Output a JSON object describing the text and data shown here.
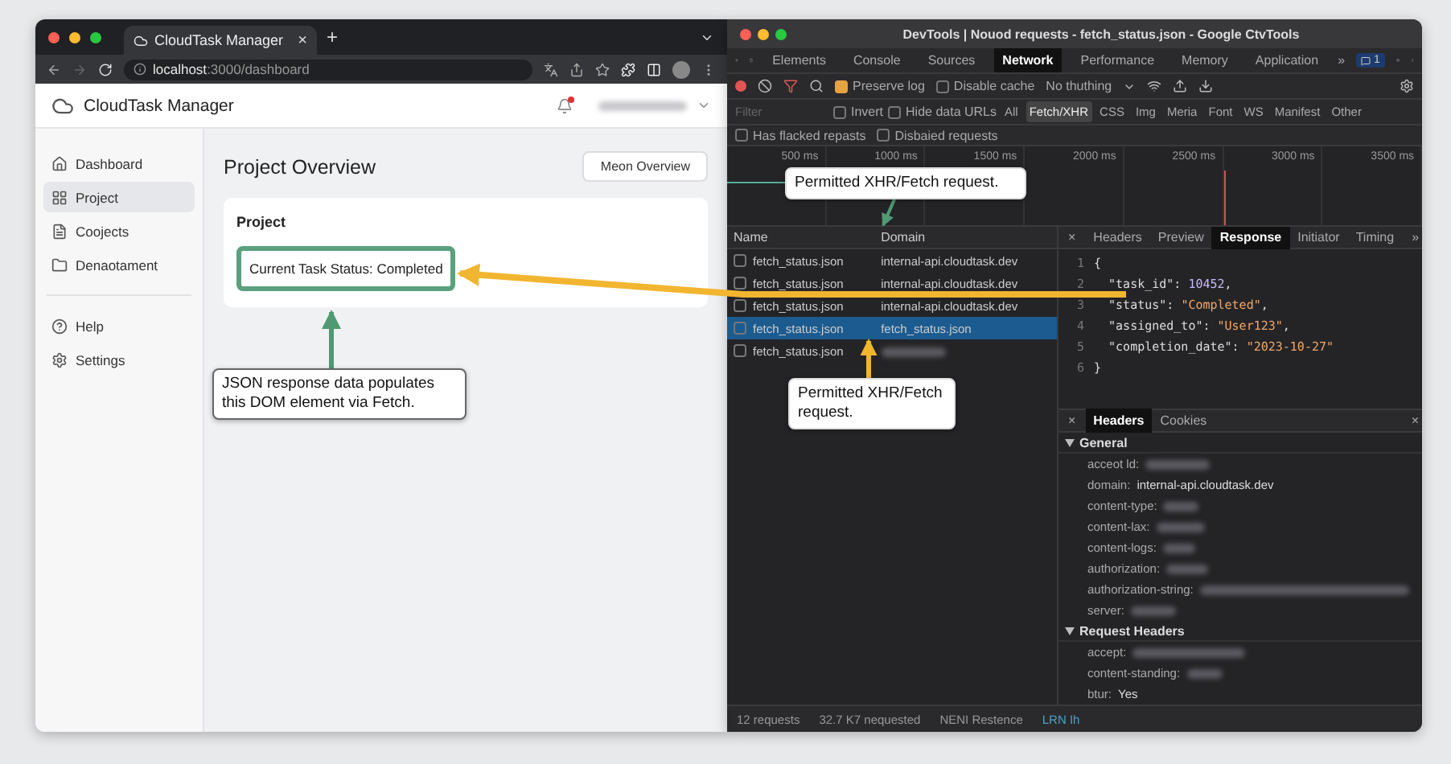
{
  "browser": {
    "tab_title": "CloudTask Manager",
    "tab_close": "×",
    "new_tab": "+",
    "url_host": "localhost",
    "url_path": ":3000/dashboard"
  },
  "app": {
    "brand": "CloudTask Manager",
    "nav": [
      {
        "label": "Dashboard",
        "selected": false
      },
      {
        "label": "Project",
        "selected": true
      },
      {
        "label": "Coojects",
        "selected": false
      },
      {
        "label": "Denaotament",
        "selected": false
      }
    ],
    "nav_footer": [
      {
        "label": "Help",
        "selected": false
      },
      {
        "label": "Settings",
        "selected": false
      }
    ],
    "title": "Project Overview",
    "button": "Meon Overview",
    "card_title": "Project",
    "status_text": "Current Task Status: Completed"
  },
  "annotations": {
    "dom_note": "JSON response data populates this DOM element via Fetch.",
    "xhr_note_top": "Permitted XHR/Fetch request.",
    "xhr_note_bottom": "Permitted XHR/Fetch request."
  },
  "devtools": {
    "title": "DevTools | Nouod requests - fetch_status.json - Google CtvTools",
    "tabs": [
      {
        "label": "Elements",
        "selected": false
      },
      {
        "label": "Console",
        "selected": false
      },
      {
        "label": "Sources",
        "selected": false
      },
      {
        "label": "Network",
        "selected": true
      },
      {
        "label": "Performance",
        "selected": false
      },
      {
        "label": "Memory",
        "selected": false
      },
      {
        "label": "Application",
        "selected": false
      }
    ],
    "more": "»",
    "badge": "1",
    "preserve_log": {
      "label": "Preserve log",
      "checked": true
    },
    "disable_cache": {
      "label": "Disable cache",
      "checked": false
    },
    "throttling": "No thuthing",
    "filter_placeholder": "Filter",
    "filter_checks": [
      {
        "label": "Invert",
        "checked": false
      },
      {
        "label": "Hide data URLs",
        "checked": false
      }
    ],
    "types": [
      {
        "label": "All",
        "selected": false
      },
      {
        "label": "Fetch/XHR",
        "selected": true
      },
      {
        "label": "CSS",
        "selected": false
      },
      {
        "label": "Img",
        "selected": false
      },
      {
        "label": "Meria",
        "selected": false
      },
      {
        "label": "Font",
        "selected": false
      },
      {
        "label": "WS",
        "selected": false
      },
      {
        "label": "Manifest",
        "selected": false
      },
      {
        "label": "Other",
        "selected": false
      }
    ],
    "extra_checks": [
      {
        "label": "Has flacked repasts",
        "checked": false
      },
      {
        "label": "Disbaied requests",
        "checked": false
      }
    ],
    "ticks": [
      "500 ms",
      "1000 ms",
      "1500 ms",
      "2000 ms",
      "2500 ms",
      "3000 ms",
      "3500 ms"
    ],
    "columns": [
      "Name",
      "Domain"
    ],
    "rows": [
      {
        "name": "fetch_status.json",
        "domain": "internal-api.cloudtask.dev",
        "selected": false
      },
      {
        "name": "fetch_status.json",
        "domain": "internal-api.cloudtask.dev",
        "selected": false
      },
      {
        "name": "fetch_status.json",
        "domain": "internal-api.cloudtask.dev",
        "selected": false
      },
      {
        "name": "fetch_status.json",
        "domain": "fetch_status.json",
        "selected": true
      },
      {
        "name": "fetch_status.json",
        "selected": false
      }
    ],
    "detail_close": "×",
    "detail_tabs": [
      {
        "label": "Headers",
        "selected": false
      },
      {
        "label": "Preview",
        "selected": false
      },
      {
        "label": "Response",
        "selected": true
      },
      {
        "label": "Initiator",
        "selected": false
      },
      {
        "label": "Timing",
        "selected": false
      }
    ],
    "detail_more": "»",
    "code": [
      {
        "number": "1",
        "text": "{"
      },
      {
        "number": "2",
        "key": "\"task_id\": ",
        "value": "10452",
        "kind": "number",
        "tail": ","
      },
      {
        "number": "3",
        "key": "\"status\": ",
        "value": "\"Completed\"",
        "kind": "string",
        "tail": ","
      },
      {
        "number": "4",
        "key": "\"assigned_to\": ",
        "value": "\"User123\"",
        "kind": "string",
        "tail": ","
      },
      {
        "number": "5",
        "key": "\"completion_date\": ",
        "value": "\"2023-10-27\"",
        "kind": "string"
      },
      {
        "number": "6",
        "text": "}"
      }
    ],
    "headers_close": "×",
    "headers_tabs": [
      {
        "label": "Headers",
        "selected": true
      },
      {
        "label": "Cookies",
        "selected": false
      }
    ],
    "headers_close_right": "×",
    "sections": [
      {
        "title": "General",
        "rows": [
          {
            "name": "acceot ld:"
          },
          {
            "name": "domain:",
            "value": "internal-api.cloudtask.dev"
          },
          {
            "name": "content-type:"
          },
          {
            "name": "content-lax:"
          },
          {
            "name": "content-logs:"
          },
          {
            "name": "authorization:"
          },
          {
            "name": "authorization-string:"
          },
          {
            "name": "server:"
          }
        ]
      },
      {
        "title": "Request Headers",
        "rows": [
          {
            "name": "accept:"
          },
          {
            "name": "content-standing:"
          },
          {
            "name": "btur:",
            "value": "Yes"
          }
        ]
      }
    ],
    "status": [
      "12 requests",
      "32.7 K7 nequested",
      "NENI Restence"
    ],
    "status_link": "LRN Ih"
  }
}
